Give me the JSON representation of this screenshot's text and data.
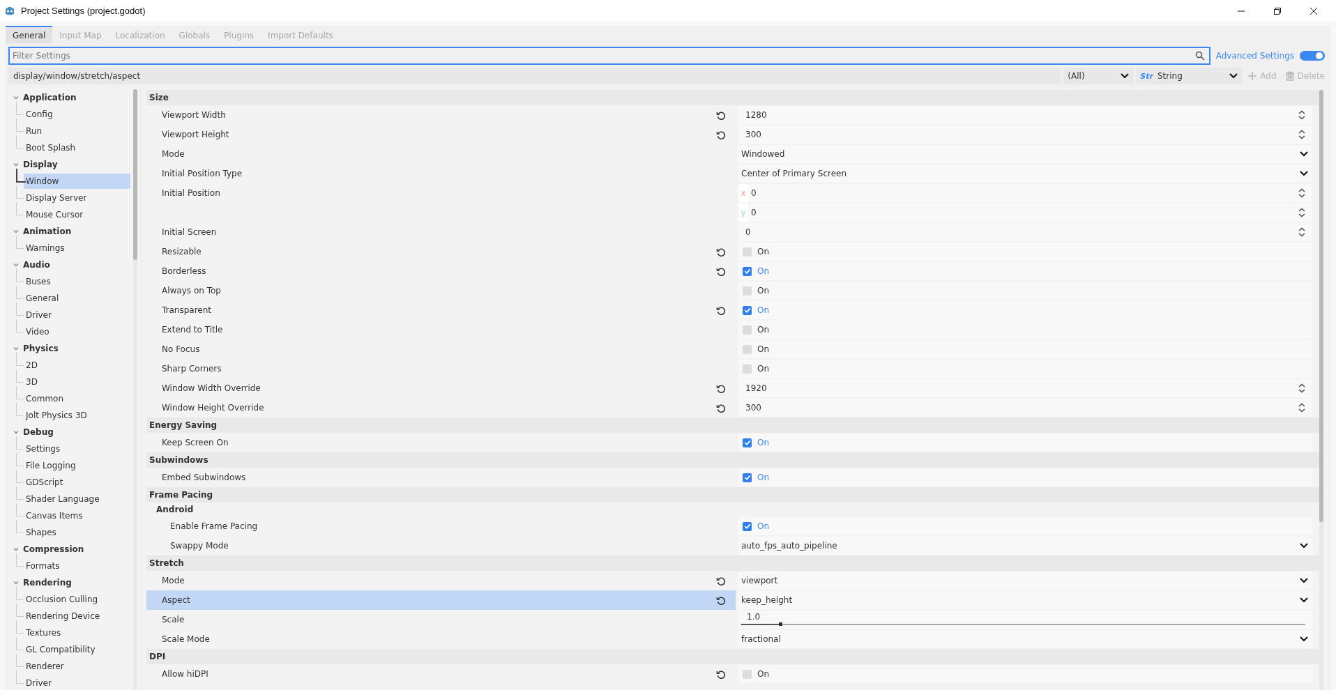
{
  "window": {
    "title": "Project Settings (project.godot)"
  },
  "tabs": [
    {
      "label": "General",
      "selected": true
    },
    {
      "label": "Input Map",
      "selected": false
    },
    {
      "label": "Localization",
      "selected": false
    },
    {
      "label": "Globals",
      "selected": false
    },
    {
      "label": "Plugins",
      "selected": false
    },
    {
      "label": "Import Defaults",
      "selected": false
    }
  ],
  "filter": {
    "placeholder": "Filter Settings"
  },
  "advanced_settings": {
    "label": "Advanced Settings",
    "on": true
  },
  "property_path": {
    "value": "display/window/stretch/aspect"
  },
  "type_filter": {
    "value": "(All)"
  },
  "type_select": {
    "icon_text": "Str",
    "value": "String"
  },
  "add_button": {
    "label": "Add",
    "disabled": true
  },
  "delete_button": {
    "label": "Delete",
    "disabled": true
  },
  "sidebar": {
    "categories": [
      {
        "label": "Application",
        "expanded": true,
        "children": [
          {
            "label": "Config",
            "selected": false
          },
          {
            "label": "Run",
            "selected": false
          },
          {
            "label": "Boot Splash",
            "selected": false
          }
        ]
      },
      {
        "label": "Display",
        "expanded": true,
        "children": [
          {
            "label": "Window",
            "selected": true
          },
          {
            "label": "Display Server",
            "selected": false
          },
          {
            "label": "Mouse Cursor",
            "selected": false
          }
        ]
      },
      {
        "label": "Animation",
        "expanded": true,
        "children": [
          {
            "label": "Warnings",
            "selected": false
          }
        ]
      },
      {
        "label": "Audio",
        "expanded": true,
        "children": [
          {
            "label": "Buses",
            "selected": false
          },
          {
            "label": "General",
            "selected": false
          },
          {
            "label": "Driver",
            "selected": false
          },
          {
            "label": "Video",
            "selected": false
          }
        ]
      },
      {
        "label": "Physics",
        "expanded": true,
        "children": [
          {
            "label": "2D",
            "selected": false
          },
          {
            "label": "3D",
            "selected": false
          },
          {
            "label": "Common",
            "selected": false
          },
          {
            "label": "Jolt Physics 3D",
            "selected": false
          }
        ]
      },
      {
        "label": "Debug",
        "expanded": true,
        "children": [
          {
            "label": "Settings",
            "selected": false
          },
          {
            "label": "File Logging",
            "selected": false
          },
          {
            "label": "GDScript",
            "selected": false
          },
          {
            "label": "Shader Language",
            "selected": false
          },
          {
            "label": "Canvas Items",
            "selected": false
          },
          {
            "label": "Shapes",
            "selected": false
          }
        ]
      },
      {
        "label": "Compression",
        "expanded": true,
        "children": [
          {
            "label": "Formats",
            "selected": false
          }
        ]
      },
      {
        "label": "Rendering",
        "expanded": true,
        "children": [
          {
            "label": "Occlusion Culling",
            "selected": false
          },
          {
            "label": "Rendering Device",
            "selected": false
          },
          {
            "label": "Textures",
            "selected": false
          },
          {
            "label": "GL Compatibility",
            "selected": false
          },
          {
            "label": "Renderer",
            "selected": false
          },
          {
            "label": "Driver",
            "selected": false
          }
        ]
      }
    ]
  },
  "sections": [
    {
      "title": "Size",
      "rows": [
        {
          "label": "Viewport Width",
          "kind": "number",
          "value": "1280",
          "revert": true,
          "selected": false
        },
        {
          "label": "Viewport Height",
          "kind": "number",
          "value": "300",
          "revert": true,
          "selected": false
        },
        {
          "label": "Mode",
          "kind": "enum",
          "value": "Windowed",
          "revert": false,
          "selected": false
        },
        {
          "label": "Initial Position Type",
          "kind": "enum",
          "value": "Center of Primary Screen",
          "revert": false,
          "selected": false
        },
        {
          "label": "Initial Position",
          "kind": "vector",
          "revert": false,
          "selected": false,
          "components": [
            {
              "axis": "x",
              "value": "0",
              "color": "#f5a38e"
            },
            {
              "axis": "y",
              "value": "0",
              "color": "#98e6b0"
            }
          ]
        },
        {
          "label": "Initial Screen",
          "kind": "number",
          "value": "0",
          "revert": false,
          "selected": false
        },
        {
          "label": "Resizable",
          "kind": "check",
          "value": "On",
          "checked": false,
          "revert": true,
          "selected": false
        },
        {
          "label": "Borderless",
          "kind": "check",
          "value": "On",
          "checked": true,
          "revert": true,
          "selected": false
        },
        {
          "label": "Always on Top",
          "kind": "check",
          "value": "On",
          "checked": false,
          "revert": false,
          "selected": false
        },
        {
          "label": "Transparent",
          "kind": "check",
          "value": "On",
          "checked": true,
          "revert": true,
          "selected": false
        },
        {
          "label": "Extend to Title",
          "kind": "check",
          "value": "On",
          "checked": false,
          "revert": false,
          "selected": false
        },
        {
          "label": "No Focus",
          "kind": "check",
          "value": "On",
          "checked": false,
          "revert": false,
          "selected": false
        },
        {
          "label": "Sharp Corners",
          "kind": "check",
          "value": "On",
          "checked": false,
          "revert": false,
          "selected": false
        },
        {
          "label": "Window Width Override",
          "kind": "number",
          "value": "1920",
          "revert": true,
          "selected": false
        },
        {
          "label": "Window Height Override",
          "kind": "number",
          "value": "300",
          "revert": true,
          "selected": false
        }
      ]
    },
    {
      "title": "Energy Saving",
      "rows": [
        {
          "label": "Keep Screen On",
          "kind": "check",
          "value": "On",
          "checked": true,
          "revert": false,
          "selected": false
        }
      ]
    },
    {
      "title": "Subwindows",
      "rows": [
        {
          "label": "Embed Subwindows",
          "kind": "check",
          "value": "On",
          "checked": true,
          "revert": false,
          "selected": false
        }
      ]
    },
    {
      "title": "Frame Pacing",
      "subsections": [
        {
          "title": "Android",
          "rows": [
            {
              "label": "Enable Frame Pacing",
              "kind": "check",
              "value": "On",
              "checked": true,
              "revert": false,
              "selected": false
            },
            {
              "label": "Swappy Mode",
              "kind": "enum",
              "value": "auto_fps_auto_pipeline",
              "revert": false,
              "selected": false
            }
          ]
        }
      ]
    },
    {
      "title": "Stretch",
      "rows": [
        {
          "label": "Mode",
          "kind": "enum",
          "value": "viewport",
          "revert": true,
          "selected": false
        },
        {
          "label": "Aspect",
          "kind": "enum",
          "value": "keep_height",
          "revert": true,
          "selected": true
        },
        {
          "label": "Scale",
          "kind": "slider",
          "value": "1.0",
          "level": 0.07,
          "revert": false,
          "selected": false
        },
        {
          "label": "Scale Mode",
          "kind": "enum",
          "value": "fractional",
          "revert": false,
          "selected": false
        }
      ]
    },
    {
      "title": "DPI",
      "rows": [
        {
          "label": "Allow hiDPI",
          "kind": "check",
          "value": "On",
          "checked": false,
          "revert": true,
          "selected": false
        }
      ]
    }
  ]
}
